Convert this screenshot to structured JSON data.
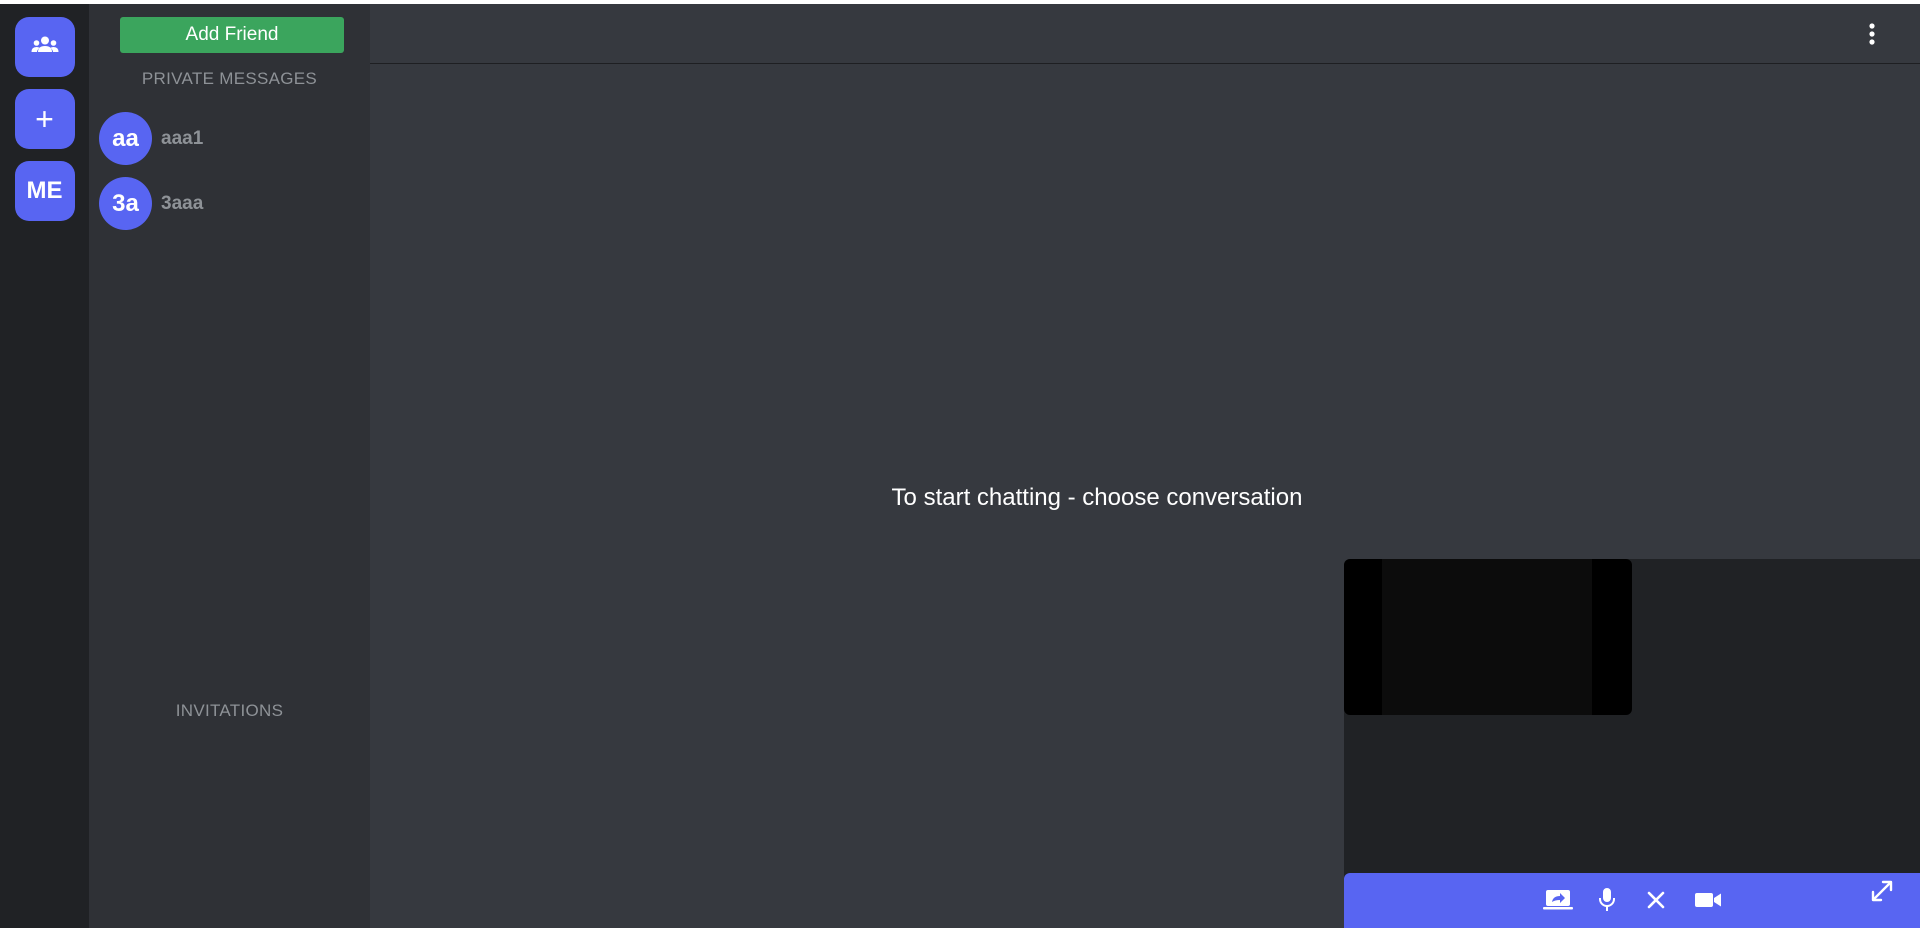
{
  "rail": {
    "items": [
      {
        "icon": "group-icon"
      },
      {
        "icon": "plus-icon",
        "label": "+"
      },
      {
        "label": "ME"
      }
    ],
    "accent": "#5865f2",
    "background": "#202225"
  },
  "sidebar": {
    "add_friend_label": "Add Friend",
    "private_messages_title": "PRIVATE MESSAGES",
    "conversations": [
      {
        "initials": "aa",
        "name": "aaa1"
      },
      {
        "initials": "3a",
        "name": "3aaa"
      }
    ],
    "invitations_title": "INVITATIONS",
    "button_color": "#3ba55d"
  },
  "main": {
    "empty_state": "To start chatting - choose conversation",
    "menu_icon": "kebab-menu-icon"
  },
  "call": {
    "controls": [
      {
        "name": "share-screen-icon"
      },
      {
        "name": "microphone-icon"
      },
      {
        "name": "hang-up-icon"
      },
      {
        "name": "camera-icon"
      },
      {
        "name": "expand-icon"
      }
    ],
    "bar_color": "#5865f2"
  }
}
